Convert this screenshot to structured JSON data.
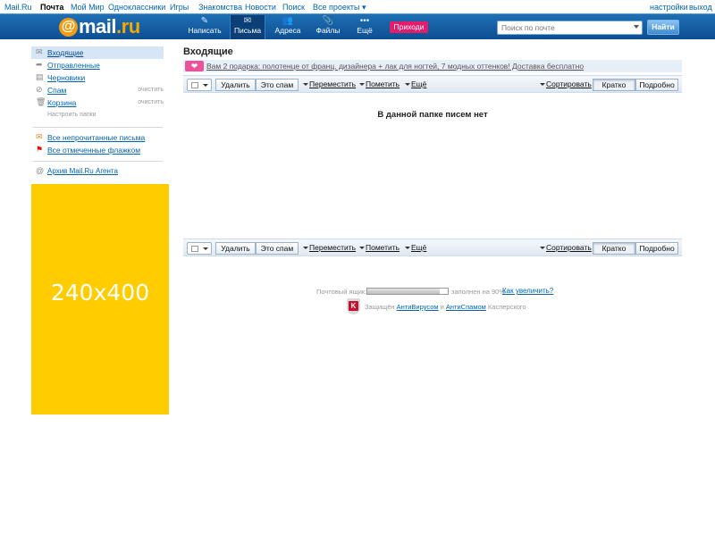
{
  "topbar": {
    "links": [
      "Mail.Ru",
      "Почта",
      "Мой Мир",
      "Одноклассники",
      "Игры",
      "Знакомства",
      "Новости",
      "Поиск",
      "Все проекты"
    ],
    "settings": "настройки",
    "logout": "выход"
  },
  "header": {
    "logo_at": "@",
    "logo_text": "mail",
    "logo_tld": ".ru",
    "nav": [
      {
        "label": "Написать",
        "icon": "pencil-icon"
      },
      {
        "label": "Письма",
        "icon": "envelope-icon"
      },
      {
        "label": "Адреса",
        "icon": "contacts-icon"
      },
      {
        "label": "Файлы",
        "icon": "paperclip-icon"
      },
      {
        "label": "Ещё",
        "icon": "dots-icon"
      }
    ],
    "promo": "Приходи",
    "search_placeholder": "Поиск по почте",
    "search_button": "Найти"
  },
  "sidebar": {
    "folders": [
      {
        "name": "Входящие",
        "icon": "inbox-icon"
      },
      {
        "name": "Отправленные",
        "icon": "sent-icon"
      },
      {
        "name": "Черновики",
        "icon": "drafts-icon"
      },
      {
        "name": "Спам",
        "icon": "spam-icon",
        "clear": "очистить"
      },
      {
        "name": "Корзина",
        "icon": "trash-icon",
        "clear": "очистить"
      }
    ],
    "configure": "Настроить папки",
    "filters": [
      {
        "name": "Все непрочитанные письма",
        "icon": "unread-icon"
      },
      {
        "name": "Все отмеченные флажком",
        "icon": "flag-icon"
      }
    ],
    "agent_archive": "Архив Mail.Ru Агента",
    "ad_text": "240x400"
  },
  "main": {
    "title": "Входящие",
    "promo_text": "Вам 2 подарка: полотенце от франц. дизайнера + лак для ногтей, 7 модных оттенков! Доставка бесплатно",
    "toolbar": {
      "delete": "Удалить",
      "spam": "Это спам",
      "move": "Переместить",
      "mark": "Пометить",
      "more": "Ещё",
      "sort": "Сортировать",
      "brief": "Кратко",
      "detailed": "Подробно"
    },
    "empty_message": "В данной папке писем нет",
    "quota": {
      "label": "Почтовый ящик:",
      "fill_fraction": 0.9,
      "text": "заполнен на 90%",
      "increase": "Как увеличить?"
    },
    "protection": {
      "prefix": "Защищён",
      "antivirus": "АнтиВирусом",
      "and": "и",
      "antispam": "АнтиСпамом",
      "suffix": "Касперского"
    }
  },
  "colors": {
    "header_blue": "#1560a8",
    "link": "#0066b3",
    "promo_pink": "#e31c6c",
    "ad_yellow": "#ffcc00"
  }
}
